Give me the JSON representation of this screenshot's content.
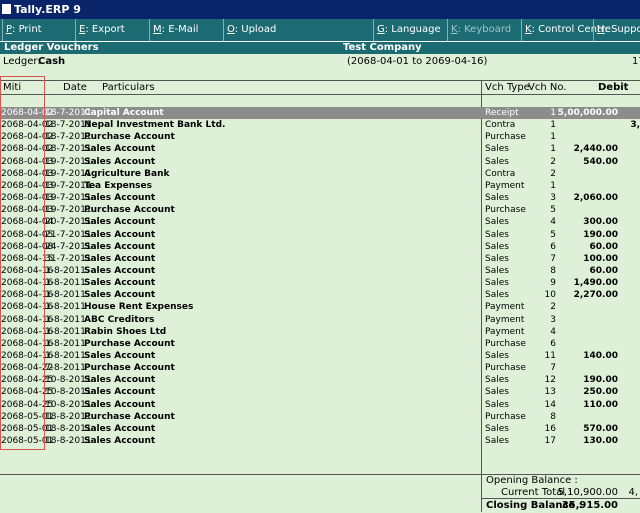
{
  "window": {
    "title": "Tally.ERP 9"
  },
  "toolbar": {
    "buttons": [
      {
        "key": "P",
        "label": ": Print",
        "enabled": true
      },
      {
        "key": "E",
        "label": ": Export",
        "enabled": true
      },
      {
        "key": "M",
        "label": ": E-Mail",
        "enabled": true
      },
      {
        "key": "O",
        "label": ": Upload",
        "enabled": true
      },
      {
        "key": "G",
        "label": ": Language",
        "enabled": true
      },
      {
        "key": "K",
        "label": ": Keyboard",
        "enabled": false
      },
      {
        "key": "K",
        "label": ": Control Centre",
        "enabled": true
      },
      {
        "key": "H",
        "label": ": Support C",
        "enabled": true
      }
    ]
  },
  "report": {
    "name": "Ledger Vouchers",
    "company": "Test Company",
    "ledger_label": "Ledger:",
    "ledger_name": "Cash",
    "period": "(2068-04-01 to 2069-04-16)",
    "right_edge": "17"
  },
  "columns": {
    "miti": "Miti",
    "date": "Date",
    "particulars": "Particulars",
    "vch_type": "Vch Type",
    "vch_no": "Vch No.",
    "debit": "Debit"
  },
  "rows": [
    {
      "miti": "2068-04-02",
      "date": "18-7-2011",
      "particulars": "Capital Account",
      "vch_type": "Receipt",
      "vch_no": "1",
      "debit": "5,00,000.00",
      "credit": ""
    },
    {
      "miti": "2068-04-02",
      "date": "18-7-2011",
      "particulars": "Nepal Investment Bank Ltd.",
      "vch_type": "Contra",
      "vch_no": "1",
      "debit": "",
      "credit": "3,"
    },
    {
      "miti": "2068-04-02",
      "date": "18-7-2011",
      "particulars": "Purchase Account",
      "vch_type": "Purchase",
      "vch_no": "1",
      "debit": "",
      "credit": ""
    },
    {
      "miti": "2068-04-02",
      "date": "18-7-2011",
      "particulars": "Sales Account",
      "vch_type": "Sales",
      "vch_no": "1",
      "debit": "2,440.00",
      "credit": ""
    },
    {
      "miti": "2068-04-03",
      "date": "19-7-2011",
      "particulars": "Sales Account",
      "vch_type": "Sales",
      "vch_no": "2",
      "debit": "540.00",
      "credit": ""
    },
    {
      "miti": "2068-04-03",
      "date": "19-7-2011",
      "particulars": "Agriculture Bank",
      "vch_type": "Contra",
      "vch_no": "2",
      "debit": "",
      "credit": ""
    },
    {
      "miti": "2068-04-03",
      "date": "19-7-2011",
      "particulars": "Tea Expenses",
      "vch_type": "Payment",
      "vch_no": "1",
      "debit": "",
      "credit": ""
    },
    {
      "miti": "2068-04-03",
      "date": "19-7-2011",
      "particulars": "Sales Account",
      "vch_type": "Sales",
      "vch_no": "3",
      "debit": "2,060.00",
      "credit": ""
    },
    {
      "miti": "2068-04-03",
      "date": "19-7-2011",
      "particulars": "Purchase Account",
      "vch_type": "Purchase",
      "vch_no": "5",
      "debit": "",
      "credit": ""
    },
    {
      "miti": "2068-04-04",
      "date": "20-7-2011",
      "particulars": "Sales Account",
      "vch_type": "Sales",
      "vch_no": "4",
      "debit": "300.00",
      "credit": ""
    },
    {
      "miti": "2068-04-05",
      "date": "21-7-2011",
      "particulars": "Sales Account",
      "vch_type": "Sales",
      "vch_no": "5",
      "debit": "190.00",
      "credit": ""
    },
    {
      "miti": "2068-04-08",
      "date": "24-7-2011",
      "particulars": "Sales Account",
      "vch_type": "Sales",
      "vch_no": "6",
      "debit": "60.00",
      "credit": ""
    },
    {
      "miti": "2068-04-15",
      "date": "31-7-2011",
      "particulars": "Sales Account",
      "vch_type": "Sales",
      "vch_no": "7",
      "debit": "100.00",
      "credit": ""
    },
    {
      "miti": "2068-04-16",
      "date": "1-8-2011",
      "particulars": "Sales Account",
      "vch_type": "Sales",
      "vch_no": "8",
      "debit": "60.00",
      "credit": ""
    },
    {
      "miti": "2068-04-16",
      "date": "1-8-2011",
      "particulars": "Sales Account",
      "vch_type": "Sales",
      "vch_no": "9",
      "debit": "1,490.00",
      "credit": ""
    },
    {
      "miti": "2068-04-16",
      "date": "1-8-2011",
      "particulars": "Sales Account",
      "vch_type": "Sales",
      "vch_no": "10",
      "debit": "2,270.00",
      "credit": ""
    },
    {
      "miti": "2068-04-16",
      "date": "1-8-2011",
      "particulars": "House Rent Expenses",
      "vch_type": "Payment",
      "vch_no": "2",
      "debit": "",
      "credit": ""
    },
    {
      "miti": "2068-04-16",
      "date": "1-8-2011",
      "particulars": "ABC Creditors",
      "vch_type": "Payment",
      "vch_no": "3",
      "debit": "",
      "credit": ""
    },
    {
      "miti": "2068-04-16",
      "date": "1-8-2011",
      "particulars": "Rabin Shoes Ltd",
      "vch_type": "Payment",
      "vch_no": "4",
      "debit": "",
      "credit": ""
    },
    {
      "miti": "2068-04-16",
      "date": "1-8-2011",
      "particulars": "Purchase Account",
      "vch_type": "Purchase",
      "vch_no": "6",
      "debit": "",
      "credit": ""
    },
    {
      "miti": "2068-04-16",
      "date": "1-8-2011",
      "particulars": "Sales Account",
      "vch_type": "Sales",
      "vch_no": "11",
      "debit": "140.00",
      "credit": ""
    },
    {
      "miti": "2068-04-22",
      "date": "7-8-2011",
      "particulars": "Purchase Account",
      "vch_type": "Purchase",
      "vch_no": "7",
      "debit": "",
      "credit": ""
    },
    {
      "miti": "2068-04-25",
      "date": "10-8-2011",
      "particulars": "Sales Account",
      "vch_type": "Sales",
      "vch_no": "12",
      "debit": "190.00",
      "credit": ""
    },
    {
      "miti": "2068-04-25",
      "date": "10-8-2011",
      "particulars": "Sales Account",
      "vch_type": "Sales",
      "vch_no": "13",
      "debit": "250.00",
      "credit": ""
    },
    {
      "miti": "2068-04-25",
      "date": "10-8-2011",
      "particulars": "Sales Account",
      "vch_type": "Sales",
      "vch_no": "14",
      "debit": "110.00",
      "credit": ""
    },
    {
      "miti": "2068-05-01",
      "date": "18-8-2011",
      "particulars": "Purchase Account",
      "vch_type": "Purchase",
      "vch_no": "8",
      "debit": "",
      "credit": ""
    },
    {
      "miti": "2068-05-01",
      "date": "18-8-2011",
      "particulars": "Sales Account",
      "vch_type": "Sales",
      "vch_no": "16",
      "debit": "570.00",
      "credit": ""
    },
    {
      "miti": "2068-05-01",
      "date": "18-8-2011",
      "particulars": "Sales Account",
      "vch_type": "Sales",
      "vch_no": "17",
      "debit": "130.00",
      "credit": ""
    }
  ],
  "footer": {
    "opening_label": "Opening Balance :",
    "current_label": "Current Total :",
    "current_debit": "5,10,900.00",
    "current_credit": "4,",
    "closing_label": "Closing Balance :",
    "closing_debit": "35,915.00"
  },
  "colors": {
    "background": "#dff0d8",
    "toolbar": "#1d6b72",
    "titlebar": "#0a246a",
    "selected_row": "#8c8c8c",
    "highlight_box": "#d9534f"
  }
}
